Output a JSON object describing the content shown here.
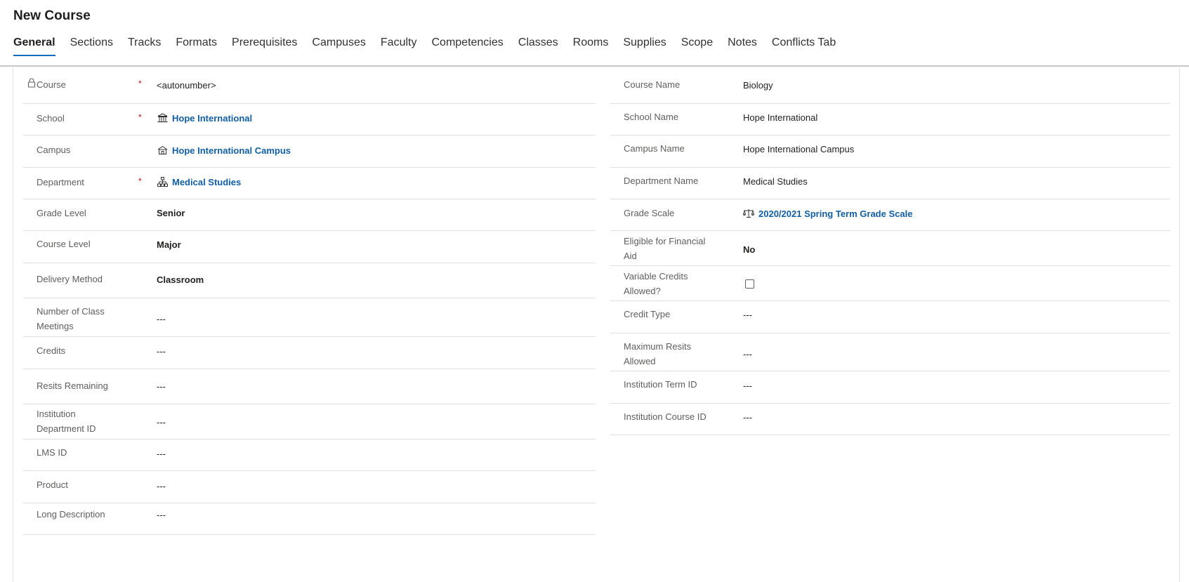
{
  "page_title": "New Course",
  "tabs": [
    "General",
    "Sections",
    "Tracks",
    "Formats",
    "Prerequisites",
    "Campuses",
    "Faculty",
    "Competencies",
    "Classes",
    "Rooms",
    "Supplies",
    "Scope",
    "Notes",
    "Conflicts Tab"
  ],
  "active_tab": "General",
  "required_marker": "*",
  "left_fields": {
    "course": {
      "label": "Course",
      "value": "<autonumber>",
      "required": true,
      "locked": true
    },
    "school": {
      "label": "School",
      "value": "Hope International",
      "required": true,
      "icon": "building-icon"
    },
    "campus": {
      "label": "Campus",
      "value": "Hope International Campus",
      "icon": "campus-icon"
    },
    "department": {
      "label": "Department",
      "value": "Medical Studies",
      "required": true,
      "icon": "org-chart-icon"
    },
    "grade_level": {
      "label": "Grade Level",
      "value": "Senior"
    },
    "course_level": {
      "label": "Course Level",
      "value": "Major"
    },
    "delivery_method": {
      "label": "Delivery Method",
      "value": "Classroom"
    },
    "number_of_class_meetings": {
      "label_line1": "Number of Class",
      "label_line2": "Meetings",
      "value": "---"
    },
    "credits": {
      "label": "Credits",
      "value": "---"
    },
    "resits_remaining": {
      "label": "Resits Remaining",
      "value": "---"
    },
    "institution_department_id": {
      "label_line1": "Institution",
      "label_line2": "Department ID",
      "value": "---"
    },
    "lms_id": {
      "label": "LMS ID",
      "value": "---"
    },
    "product": {
      "label": "Product",
      "value": "---"
    },
    "long_description": {
      "label": "Long Description",
      "value": "---"
    }
  },
  "right_fields": {
    "course_name": {
      "label": "Course Name",
      "value": "Biology"
    },
    "school_name": {
      "label": "School Name",
      "value": "Hope International"
    },
    "campus_name": {
      "label": "Campus Name",
      "value": "Hope International Campus"
    },
    "department_name": {
      "label": "Department Name",
      "value": "Medical Studies"
    },
    "grade_scale": {
      "label": "Grade Scale",
      "value": "2020/2021 Spring Term Grade Scale",
      "icon": "scale-icon"
    },
    "eligible_for_financial_aid": {
      "label_line1": "Eligible for Financial",
      "label_line2": "Aid",
      "value": "No"
    },
    "variable_credits_allowed": {
      "label_line1": "Variable Credits",
      "label_line2": "Allowed?",
      "checked": false
    },
    "credit_type": {
      "label": "Credit Type",
      "value": "---"
    },
    "maximum_resits_allowed": {
      "label_line1": "Maximum Resits",
      "label_line2": "Allowed",
      "value": "---"
    },
    "institution_term_id": {
      "label": "Institution Term ID",
      "value": "---"
    },
    "institution_course_id": {
      "label": "Institution Course ID",
      "value": "---"
    }
  },
  "colors": {
    "link": "#115ea3",
    "required": "#c50f1f",
    "tab_underline": "#0f6cbd",
    "divider": "#e1dfdd"
  }
}
